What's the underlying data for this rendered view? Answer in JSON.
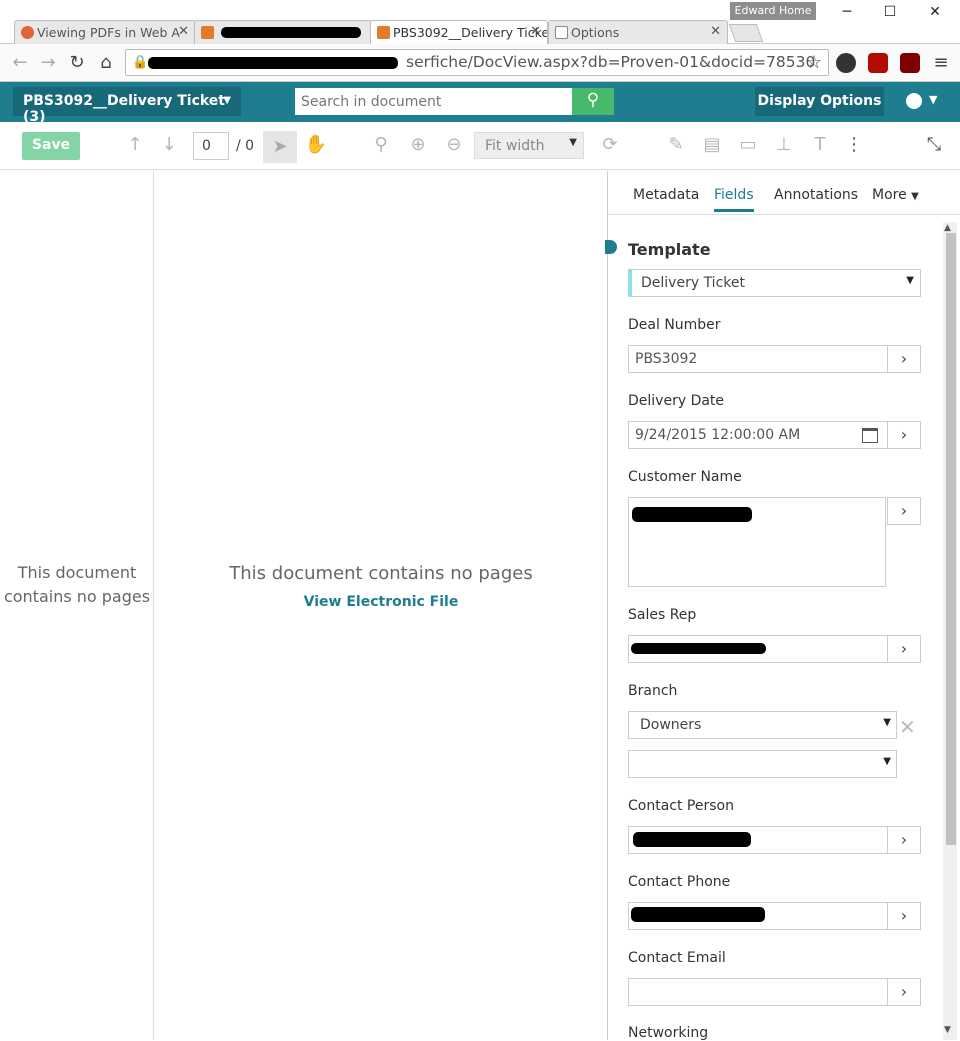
{
  "browser": {
    "profile_name": "Edward Home",
    "tabs": [
      {
        "title": "Viewing PDFs in Web A",
        "favicon_color": "#e2623b"
      },
      {
        "title": "",
        "favicon_color": "#e07b28"
      },
      {
        "title": "PBS3092__Delivery Ticke",
        "favicon_color": "#e07b28"
      },
      {
        "title": "Options",
        "favicon_color": "#888888"
      }
    ],
    "url": "serfiche/DocView.aspx?db=Proven-01&docid=78530"
  },
  "app": {
    "doc_title": "PBS3092__Delivery Ticket (3)",
    "search_placeholder": "Search in document",
    "display_options_label": "Display Options",
    "accent": "#1e7d8e",
    "search_button_color": "#48b86b"
  },
  "toolbar": {
    "save_label": "Save",
    "page_current": "0",
    "page_total": "/ 0",
    "zoom_value": "Fit width"
  },
  "thumb_pane": {
    "message": "This document contains no pages"
  },
  "viewer": {
    "message": "This document contains no pages",
    "link_label": "View Electronic File"
  },
  "side_panel": {
    "tabs": [
      "Metadata",
      "Fields",
      "Annotations",
      "More"
    ],
    "active_tab": "Fields",
    "template_heading": "Template",
    "template_value": "Delivery Ticket",
    "fields": {
      "deal_number": {
        "label": "Deal Number",
        "value": "PBS3092"
      },
      "delivery_date": {
        "label": "Delivery Date",
        "value": "9/24/2015 12:00:00 AM"
      },
      "customer_name": {
        "label": "Customer Name",
        "value": ""
      },
      "sales_rep": {
        "label": "Sales Rep",
        "value": ""
      },
      "branch": {
        "label": "Branch",
        "value": "Downers",
        "value2": ""
      },
      "contact_person": {
        "label": "Contact Person",
        "value": ""
      },
      "contact_phone": {
        "label": "Contact Phone",
        "value": ""
      },
      "contact_email": {
        "label": "Contact Email",
        "value": ""
      },
      "networking": {
        "label": "Networking"
      }
    }
  }
}
